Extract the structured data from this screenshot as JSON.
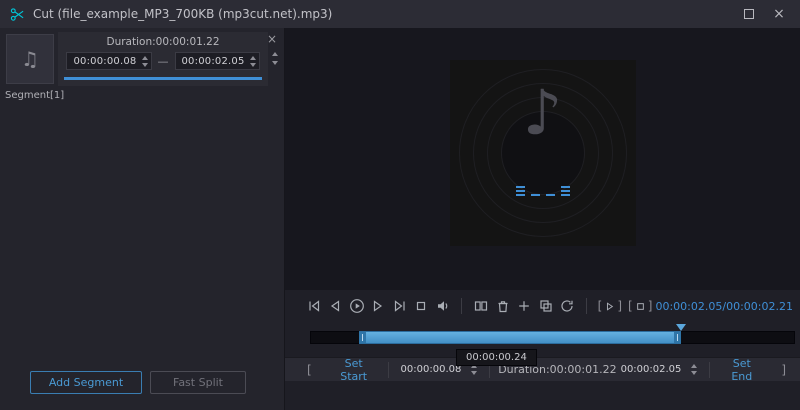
{
  "window": {
    "title": "Cut (file_example_MP3_700KB (mp3cut.net).mp3)"
  },
  "glyphs": {
    "close": "×",
    "dash": "—",
    "slash": "/",
    "album_note": "♪",
    "thumb_note": "♫",
    "bracket_left": "[",
    "bracket_right": "]"
  },
  "left_panel": {
    "segment_card": {
      "duration_label": "Duration:00:00:01.22",
      "start_value": "00:00:00.08",
      "end_value": "00:00:02.05",
      "progress_pct": 100
    },
    "segment_label": "Segment[1]",
    "add_segment_button": "Add Segment",
    "fast_split_button": "Fast Split"
  },
  "player": {
    "current_time": "00:00:02.05",
    "total_time": "00:00:02.21"
  },
  "timeline": {
    "tooltip": "00:00:00.24",
    "selection": {
      "start_pct": 10,
      "end_pct": 76.5,
      "playhead_pct": 76.5
    }
  },
  "bottom_bar": {
    "set_start_button": "Set Start",
    "start_value": "00:00:00.08",
    "duration_label": "Duration:00:00:01.22",
    "end_value": "00:00:02.05",
    "set_end_button": "Set End"
  },
  "colors": {
    "accent": "#4a9ad4",
    "scissors": "#00c5d8",
    "timeline_fill": "#4f9cd2"
  }
}
